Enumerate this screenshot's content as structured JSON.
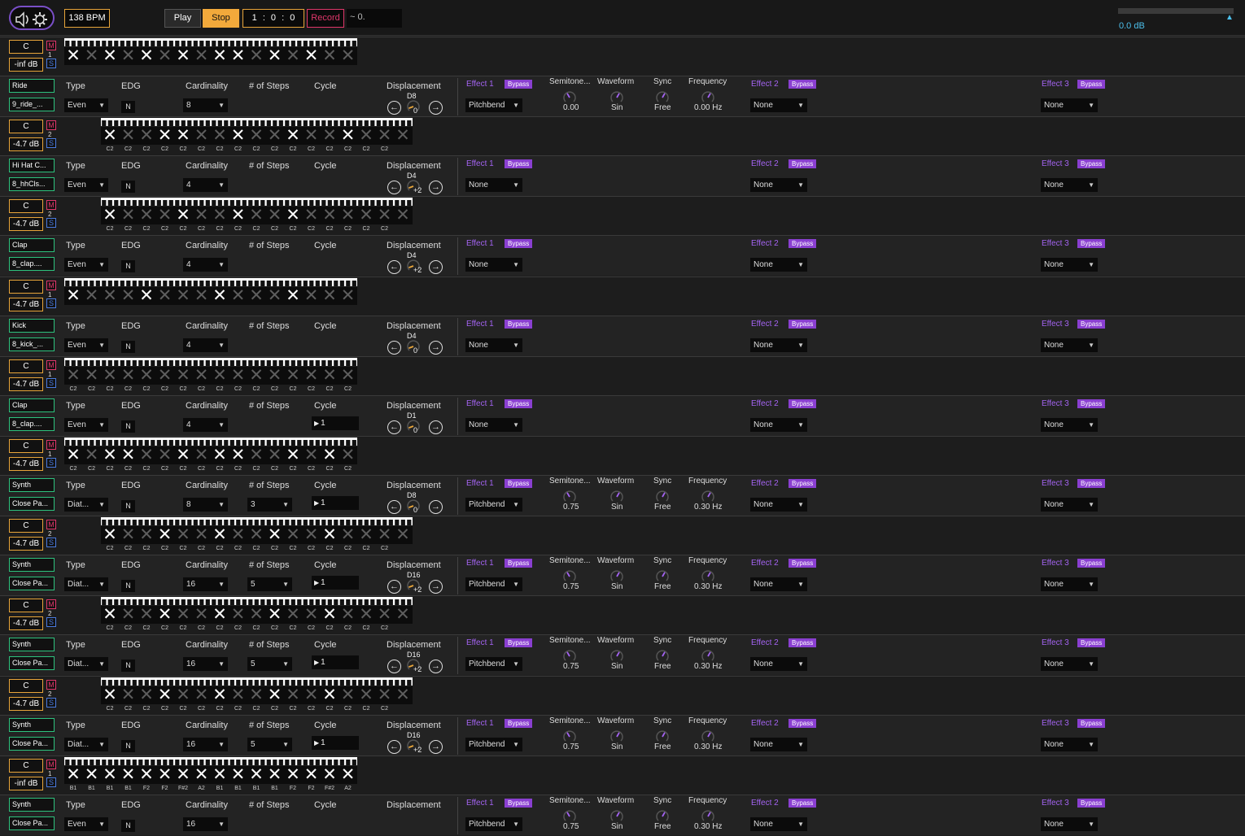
{
  "transport": {
    "bpm": "138 BPM",
    "play": "Play",
    "stop": "Stop",
    "position": "1 : 0 : 0",
    "record": "Record",
    "tempo_display": "~ 0."
  },
  "master": {
    "volume": "0.0 dB"
  },
  "colors": {
    "accent_orange": "#f2a93b",
    "record_pink": "#e0376b",
    "solo_blue": "#4a7be0",
    "effect_purple": "#a463f2",
    "bypass_bg": "#8a3fd1",
    "meter_cyan": "#4cc0ec",
    "group_green": "#2ec27e"
  },
  "labels": {
    "type": "Type",
    "edg": "EDG",
    "cardinality": "Cardinality",
    "steps": "# of Steps",
    "cycle": "Cycle",
    "displacement": "Displacement",
    "effect1": "Effect 1",
    "effect2": "Effect 2",
    "effect3": "Effect 3",
    "bypass": "Bypass",
    "semitone": "Semitone...",
    "waveform": "Waveform",
    "sync": "Sync",
    "frequency": "Frequency",
    "mute": "M",
    "solo": "S"
  },
  "tracks": [
    {
      "key": "C",
      "volume": "-inf dB",
      "channel": "1",
      "group": "Ride",
      "sample": "9_ride_...",
      "type": "Even",
      "edg": "N",
      "cardinality": "8",
      "steps": "",
      "cycle": "",
      "disp_label": "D8",
      "disp_value": "0",
      "effect1": "Pitchbend",
      "effect2": "None",
      "effect3": "None",
      "has_pitch": true,
      "semitone": "0.00",
      "waveform": "Sin",
      "sync": "Free",
      "frequency": "0.00 Hz",
      "grid_start": 79,
      "steps_on": "101010101101010",
      "notes": []
    },
    {
      "key": "C",
      "volume": "-4.7 dB",
      "channel": "2",
      "group": "Hi Hat C...",
      "sample": "8_hhCls...",
      "type": "Even",
      "edg": "N",
      "cardinality": "4",
      "steps": "",
      "cycle": "",
      "disp_label": "D4",
      "disp_value": "+2",
      "effect1": "None",
      "effect2": "None",
      "effect3": "None",
      "has_pitch": false,
      "semitone": "",
      "waveform": "",
      "sync": "",
      "frequency": "",
      "grid_start": 124,
      "steps_on": "1001100100100100",
      "notes": [
        "C2",
        "C2",
        "C2",
        "C2",
        "C2",
        "C2",
        "C2",
        "C2",
        "C2",
        "C2",
        "C2",
        "C2",
        "C2",
        "C2",
        "C2",
        "C2"
      ]
    },
    {
      "key": "C",
      "volume": "-4.7 dB",
      "channel": "2",
      "group": "Clap",
      "sample": "8_clap....",
      "type": "Even",
      "edg": "N",
      "cardinality": "4",
      "steps": "",
      "cycle": "",
      "disp_label": "D4",
      "disp_value": "+2",
      "effect1": "None",
      "effect2": "None",
      "effect3": "None",
      "has_pitch": false,
      "semitone": "",
      "waveform": "",
      "sync": "",
      "frequency": "",
      "grid_start": 124,
      "steps_on": "1000100100100000",
      "notes": [
        "C2",
        "C2",
        "C2",
        "C2",
        "C2",
        "C2",
        "C2",
        "C2",
        "C2",
        "C2",
        "C2",
        "C2",
        "C2",
        "C2",
        "C2",
        "C2"
      ]
    },
    {
      "key": "C",
      "volume": "-4.7 dB",
      "channel": "1",
      "group": "Kick",
      "sample": "8_kick_...",
      "type": "Even",
      "edg": "N",
      "cardinality": "4",
      "steps": "",
      "cycle": "",
      "disp_label": "D4",
      "disp_value": "0",
      "effect1": "None",
      "effect2": "None",
      "effect3": "None",
      "has_pitch": false,
      "semitone": "",
      "waveform": "",
      "sync": "",
      "frequency": "",
      "grid_start": 79,
      "steps_on": "1000100010001000",
      "notes": []
    },
    {
      "key": "C",
      "volume": "-4.7 dB",
      "channel": "1",
      "group": "Clap",
      "sample": "8_clap....",
      "type": "Even",
      "edg": "N",
      "cardinality": "4",
      "steps": "",
      "cycle": "1",
      "disp_label": "D1",
      "disp_value": "0",
      "effect1": "None",
      "effect2": "None",
      "effect3": "None",
      "has_pitch": false,
      "semitone": "",
      "waveform": "",
      "sync": "",
      "frequency": "",
      "grid_start": 79,
      "steps_on": "0000000000000000",
      "notes": [
        "C2",
        "C2",
        "C2",
        "C2",
        "C2",
        "C2",
        "C2",
        "C2",
        "C2",
        "C2",
        "C2",
        "C2",
        "C2",
        "C2",
        "C2",
        "C2"
      ]
    },
    {
      "key": "C",
      "volume": "-4.7 dB",
      "channel": "1",
      "group": "Synth",
      "sample": "Close Pa...",
      "type": "Diat...",
      "edg": "N",
      "cardinality": "8",
      "steps": "3",
      "cycle": "1",
      "disp_label": "D8",
      "disp_value": "0",
      "effect1": "Pitchbend",
      "effect2": "None",
      "effect3": "None",
      "has_pitch": true,
      "semitone": "0.75",
      "waveform": "Sin",
      "sync": "Free",
      "frequency": "0.30 Hz",
      "grid_start": 79,
      "steps_on": "1011001011001010",
      "notes": [
        "C2",
        "C2",
        "C2",
        "C2",
        "C2",
        "C2",
        "C2",
        "C2",
        "C2",
        "C2",
        "C2",
        "C2",
        "C2",
        "C2",
        "C2",
        "C2"
      ]
    },
    {
      "key": "C",
      "volume": "-4.7 dB",
      "channel": "2",
      "group": "Synth",
      "sample": "Close Pa...",
      "type": "Diat...",
      "edg": "N",
      "cardinality": "16",
      "steps": "5",
      "cycle": "1",
      "disp_label": "D16",
      "disp_value": "+2",
      "effect1": "Pitchbend",
      "effect2": "None",
      "effect3": "None",
      "has_pitch": true,
      "semitone": "0.75",
      "waveform": "Sin",
      "sync": "Free",
      "frequency": "0.30 Hz",
      "grid_start": 124,
      "steps_on": "1001001001001000",
      "notes": [
        "C2",
        "C2",
        "C2",
        "C2",
        "C2",
        "C2",
        "C2",
        "C2",
        "C2",
        "C2",
        "C2",
        "C2",
        "C2",
        "C2",
        "C2",
        "C2"
      ]
    },
    {
      "key": "C",
      "volume": "-4.7 dB",
      "channel": "2",
      "group": "Synth",
      "sample": "Close Pa...",
      "type": "Diat...",
      "edg": "N",
      "cardinality": "16",
      "steps": "5",
      "cycle": "1",
      "disp_label": "D16",
      "disp_value": "+2",
      "effect1": "Pitchbend",
      "effect2": "None",
      "effect3": "None",
      "has_pitch": true,
      "semitone": "0.75",
      "waveform": "Sin",
      "sync": "Free",
      "frequency": "0.30 Hz",
      "grid_start": 124,
      "steps_on": "1001001001001000",
      "notes": [
        "C2",
        "C2",
        "C2",
        "C2",
        "C2",
        "C2",
        "C2",
        "C2",
        "C2",
        "C2",
        "C2",
        "C2",
        "C2",
        "C2",
        "C2",
        "C2"
      ]
    },
    {
      "key": "C",
      "volume": "-4.7 dB",
      "channel": "2",
      "group": "Synth",
      "sample": "Close Pa...",
      "type": "Diat...",
      "edg": "N",
      "cardinality": "16",
      "steps": "5",
      "cycle": "1",
      "disp_label": "D16",
      "disp_value": "+2",
      "effect1": "Pitchbend",
      "effect2": "None",
      "effect3": "None",
      "has_pitch": true,
      "semitone": "0.75",
      "waveform": "Sin",
      "sync": "Free",
      "frequency": "0.30 Hz",
      "grid_start": 124,
      "steps_on": "1001001001001000",
      "notes": [
        "C2",
        "C2",
        "C2",
        "C2",
        "C2",
        "C2",
        "C2",
        "C2",
        "C2",
        "C2",
        "C2",
        "C2",
        "C2",
        "C2",
        "C2",
        "C2"
      ]
    },
    {
      "key": "C",
      "volume": "-inf dB",
      "channel": "1",
      "group": "Synth",
      "sample": "Close Pa...",
      "type": "Even",
      "edg": "N",
      "cardinality": "16",
      "steps": "",
      "cycle": "",
      "disp_label": "",
      "disp_value": "",
      "effect1": "Pitchbend",
      "effect2": "None",
      "effect3": "None",
      "has_pitch": true,
      "semitone": "0.75",
      "waveform": "Sin",
      "sync": "Free",
      "frequency": "0.30 Hz",
      "grid_start": 79,
      "steps_on": "1111111111111111",
      "notes": [
        "B1",
        "B1",
        "B1",
        "B1",
        "F2",
        "F2",
        "F#2",
        "A2",
        "B1",
        "B1",
        "B1",
        "B1",
        "F2",
        "F2",
        "F#2",
        "A2"
      ]
    }
  ]
}
